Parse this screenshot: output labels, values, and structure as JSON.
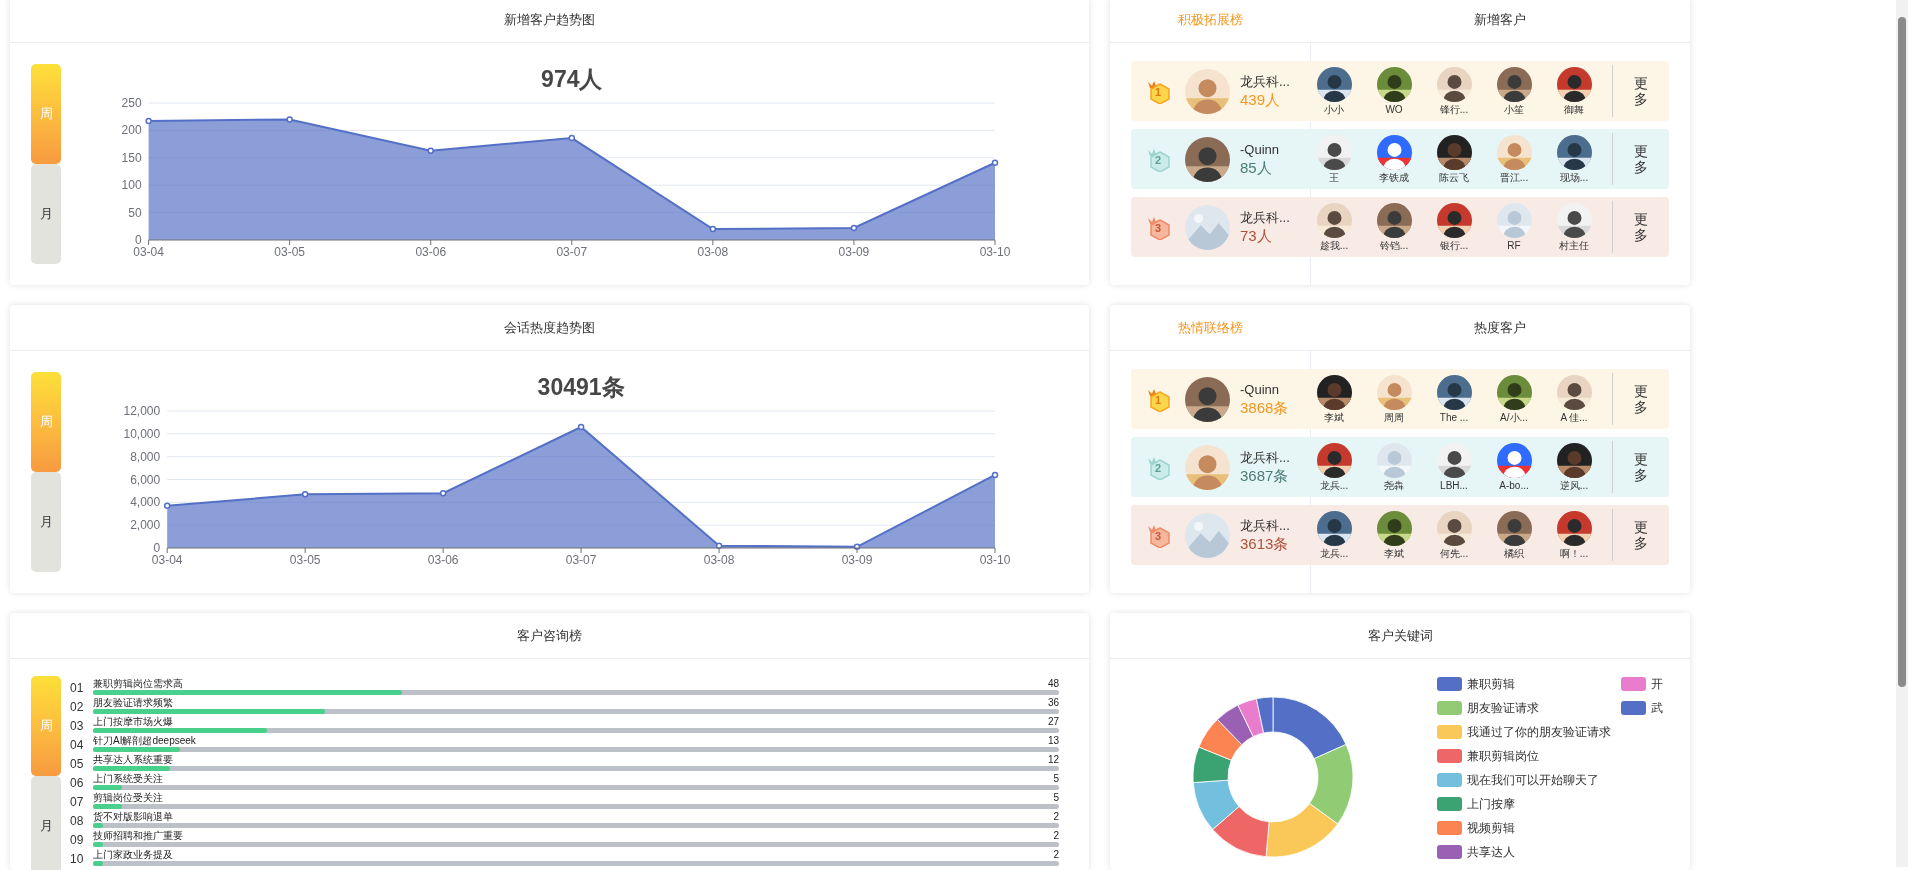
{
  "new_customer_trend": {
    "title": "新增客户趋势图",
    "periods": [
      {
        "label": "周",
        "selected": true
      },
      {
        "label": "月",
        "selected": false
      }
    ],
    "chart_data": {
      "type": "area",
      "title": "974人",
      "categories": [
        "03-04",
        "03-05",
        "03-06",
        "03-07",
        "03-08",
        "03-09",
        "03-10"
      ],
      "series": [
        {
          "color": "#5470c6",
          "values": [
            217,
            220,
            163,
            186,
            20,
            22,
            141
          ]
        }
      ],
      "ylim": [
        0,
        250
      ],
      "yticks": [
        0,
        50,
        100,
        150,
        200,
        250
      ],
      "grid": true
    }
  },
  "expand_ranking": {
    "tabs": [
      {
        "label": "积极拓展榜",
        "selected": true
      },
      {
        "label": "新增客户",
        "selected": false
      }
    ],
    "rows": [
      {
        "rank": "1",
        "name": "龙兵科...",
        "count": "439人",
        "customers": [
          "小小",
          "WO",
          "锋行...",
          "小笙",
          "御舞"
        ],
        "more": "更多"
      },
      {
        "rank": "2",
        "name": "-Quinn",
        "count": "85人",
        "customers": [
          "王",
          "李铁成",
          "陈云飞",
          "晋江...",
          "现场..."
        ],
        "more": "更多"
      },
      {
        "rank": "3",
        "name": "龙兵科...",
        "count": "73人",
        "customers": [
          "趁我...",
          "铃铛...",
          "银行...",
          "RF",
          "村主任"
        ],
        "more": "更多"
      }
    ]
  },
  "session_trend": {
    "title": "会话热度趋势图",
    "periods": [
      {
        "label": "周",
        "selected": true
      },
      {
        "label": "月",
        "selected": false
      }
    ],
    "chart_data": {
      "type": "area",
      "title": "30491条",
      "categories": [
        "03-04",
        "03-05",
        "03-06",
        "03-07",
        "03-08",
        "03-09",
        "03-10"
      ],
      "series": [
        {
          "color": "#5470c6",
          "values": [
            3700,
            4700,
            4800,
            10600,
            200,
            100,
            6400
          ]
        }
      ],
      "ylim": [
        0,
        12000
      ],
      "yticks": [
        {
          "value": 0,
          "label": "0"
        },
        {
          "value": 2000,
          "label": "2,000"
        },
        {
          "value": 4000,
          "label": "4,000"
        },
        {
          "value": 6000,
          "label": "6,000"
        },
        {
          "value": 8000,
          "label": "8,000"
        },
        {
          "value": 10000,
          "label": "10,000"
        },
        {
          "value": 12000,
          "label": "12,000"
        }
      ],
      "grid": true
    }
  },
  "contact_ranking": {
    "tabs": [
      {
        "label": "热情联络榜",
        "selected": true
      },
      {
        "label": "热度客户",
        "selected": false
      }
    ],
    "rows": [
      {
        "rank": "1",
        "name": "-Quinn",
        "count": "3868条",
        "customers": [
          "李斌",
          "周周",
          "The ...",
          "A/小...",
          "A 佳..."
        ],
        "more": "更多"
      },
      {
        "rank": "2",
        "name": "龙兵科...",
        "count": "3687条",
        "customers": [
          "龙兵...",
          "尧犇",
          "LBH...",
          "A-bo...",
          "逆风..."
        ],
        "more": "更多"
      },
      {
        "rank": "3",
        "name": "龙兵科...",
        "count": "3613条",
        "customers": [
          "龙兵...",
          "李斌",
          "何先...",
          "橘织",
          "啊！..."
        ],
        "more": "更多"
      }
    ]
  },
  "consult_ranking": {
    "title": "客户咨询榜",
    "periods": [
      {
        "label": "周",
        "selected": true
      },
      {
        "label": "月",
        "selected": false
      }
    ],
    "items": [
      {
        "index": "01",
        "label": "兼职剪辑岗位需求高",
        "value": "48",
        "level": 0.32
      },
      {
        "index": "02",
        "label": "朋友验证请求频繁",
        "value": "36",
        "level": 0.24
      },
      {
        "index": "03",
        "label": "上门按摩市场火爆",
        "value": "27",
        "level": 0.18
      },
      {
        "index": "04",
        "label": "针刀AI解剖超deepseek",
        "value": "13",
        "level": 0.09
      },
      {
        "index": "05",
        "label": "共享达人系统重要",
        "value": "12",
        "level": 0.08
      },
      {
        "index": "06",
        "label": "上门系统受关注",
        "value": "5",
        "level": 0.03
      },
      {
        "index": "07",
        "label": "剪辑岗位受关注",
        "value": "5",
        "level": 0.03
      },
      {
        "index": "08",
        "label": "货不对版影响退单",
        "value": "2",
        "level": 0.01
      },
      {
        "index": "09",
        "label": "技师招聘和推广重要",
        "value": "2",
        "level": 0.01
      },
      {
        "index": "10",
        "label": "上门家政业务提及",
        "value": "2",
        "level": 0.01
      }
    ]
  },
  "keywords": {
    "title": "客户关键词",
    "legend": [
      {
        "label": "兼职剪辑",
        "color": "#5470c6"
      },
      {
        "label": "朋友验证请求",
        "color": "#91cc75"
      },
      {
        "label": "我通过了你的朋友验证请求",
        "color": "#fac858"
      },
      {
        "label": "兼职剪辑岗位",
        "color": "#ee6666"
      },
      {
        "label": "现在我们可以开始聊天了",
        "color": "#73c0de"
      },
      {
        "label": "上门按摩",
        "color": "#3ba272"
      },
      {
        "label": "视频剪辑",
        "color": "#fc8452"
      },
      {
        "label": "共享达人",
        "color": "#9a60b4"
      },
      {
        "label": "开",
        "color": "#ea7ccc"
      },
      {
        "label": "武",
        "color": "#5470c6"
      }
    ]
  }
}
